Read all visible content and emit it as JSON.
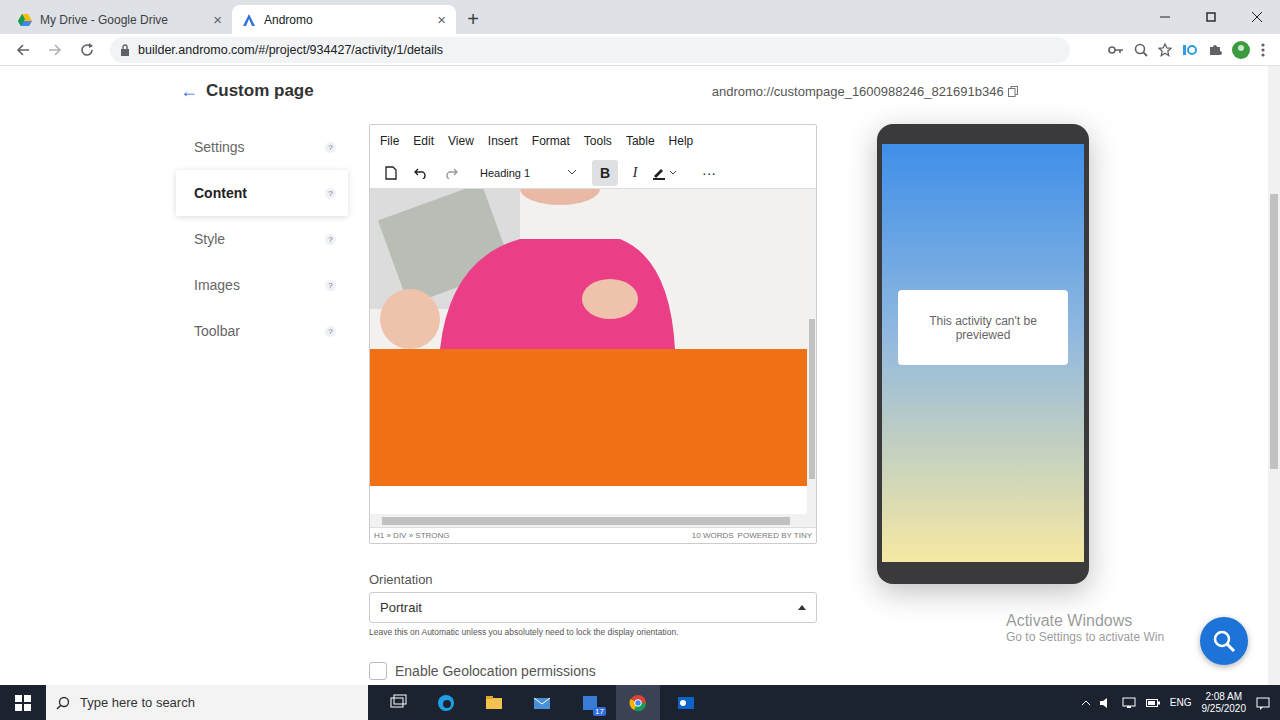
{
  "browser": {
    "tabs": [
      {
        "label": "My Drive - Google Drive",
        "selected": false,
        "close": "×"
      },
      {
        "label": "Andromo",
        "selected": true,
        "close": "×"
      }
    ],
    "new_tab": "+",
    "address": "builder.andromo.com/#/project/934427/activity/1/details"
  },
  "page": {
    "back": "←",
    "title": "Custom page",
    "slug": "andromo://custompage_1600988246_821691b346"
  },
  "nav": [
    {
      "label": "Settings",
      "selected": false,
      "help": "?"
    },
    {
      "label": "Content",
      "selected": true,
      "help": "?"
    },
    {
      "label": "Style",
      "selected": false,
      "help": "?"
    },
    {
      "label": "Images",
      "selected": false,
      "help": "?"
    },
    {
      "label": "Toolbar",
      "selected": false,
      "help": "?"
    }
  ],
  "editor": {
    "menu": [
      "File",
      "Edit",
      "View",
      "Insert",
      "Format",
      "Tools",
      "Table",
      "Help"
    ],
    "block_format": "Heading 1",
    "bold_label": "B",
    "italic_label": "I",
    "bold": true,
    "italic": false,
    "more": "···",
    "path": "H1 » DIV » STRONG",
    "words": "10 WORDS",
    "powered": "POWERED BY TINY"
  },
  "orientation": {
    "label": "Orientation",
    "value": "Portrait",
    "hint": "Leave this on Automatic unless you absolutely need to lock the display orientation."
  },
  "geolocation": {
    "label": "Enable Geolocation permissions",
    "checked": false
  },
  "preview": {
    "message": "This activity can't be previewed"
  },
  "watermark": {
    "title": "Activate Windows",
    "subtitle": "Go to Settings to activate Win"
  },
  "taskbar": {
    "search": "Type here to search",
    "badge": "17",
    "language": "ENG",
    "time": "2:08 AM",
    "date": "9/25/2020"
  }
}
